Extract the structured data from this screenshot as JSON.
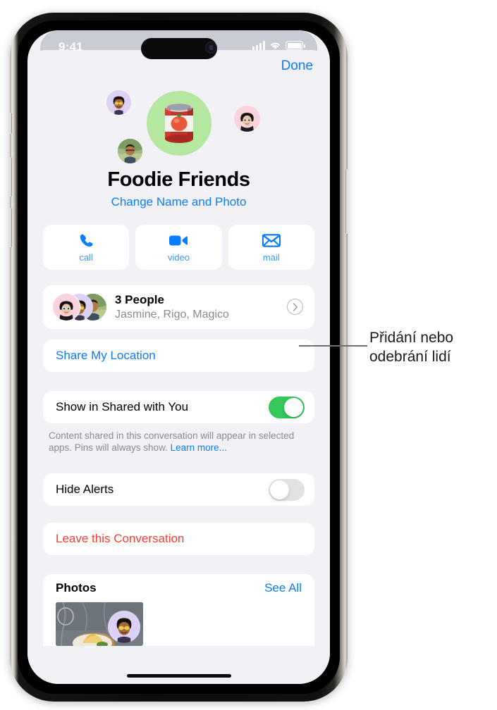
{
  "status_bar": {
    "time": "9:41",
    "signal_icon": "cellular-signal-icon",
    "wifi_icon": "wifi-icon",
    "battery_icon": "battery-icon"
  },
  "sheet": {
    "done_label": "Done"
  },
  "group": {
    "name": "Foodie Friends",
    "change_link": "Change Name and Photo",
    "photo_icon": "canned-tomato-emoji",
    "photo_bg_color": "#b4e8a0",
    "member_avatars": [
      {
        "name": "avatar-memoji-glasses",
        "bg": "#ddd2f5"
      },
      {
        "name": "avatar-memoji-pink",
        "bg": "#fbd3df"
      },
      {
        "name": "avatar-photo-outdoors",
        "bg": "#7e9c62"
      }
    ]
  },
  "actions": [
    {
      "label": "call",
      "icon": "phone-icon"
    },
    {
      "label": "video",
      "icon": "video-camera-icon"
    },
    {
      "label": "mail",
      "icon": "envelope-icon"
    }
  ],
  "people": {
    "title": "3 People",
    "subtitle": "Jasmine, Rigo, Magico",
    "chevron_icon": "chevron-right-icon"
  },
  "share_location": {
    "label": "Share My Location"
  },
  "shared_with_you": {
    "label": "Show in Shared with You",
    "toggle_state": "on",
    "toggle_color": "#34c759",
    "footnote": "Content shared in this conversation will appear in selected apps. Pins will always show. ",
    "footnote_link": "Learn more..."
  },
  "hide_alerts": {
    "label": "Hide Alerts",
    "toggle_state": "off",
    "toggle_color": "#e3e3e6"
  },
  "leave": {
    "label": "Leave this Conversation",
    "color": "#ff3b30"
  },
  "photos": {
    "title": "Photos",
    "see_all_label": "See All",
    "thumbnail_icon": "food-plate-photo",
    "overlay_avatar_icon": "avatar-memoji-glasses"
  },
  "annotation": {
    "text_line_1": "Přidání nebo",
    "text_line_2": "odebrání lidí"
  },
  "colors": {
    "accent_blue": "#0a7cff",
    "background": "#f2f1f6",
    "card": "#ffffff",
    "destructive_red": "#ff3b30",
    "toggle_green": "#34c759",
    "secondary_text": "#8b8b90"
  }
}
